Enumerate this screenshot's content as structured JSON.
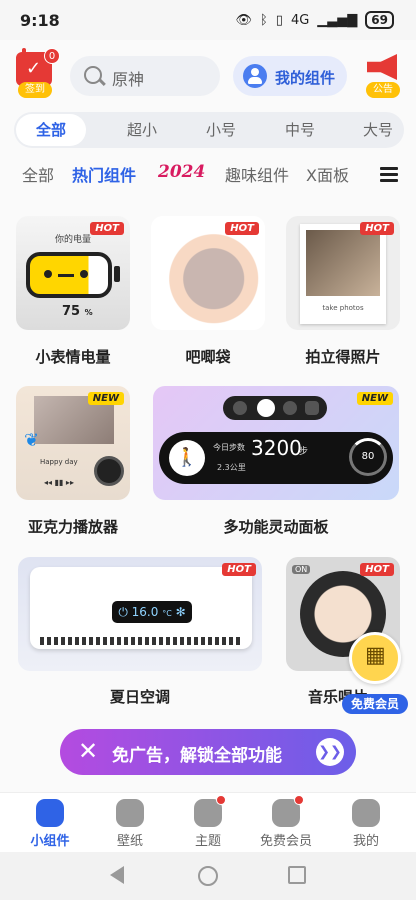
{
  "status": {
    "time": "9:18",
    "battery": "69",
    "signal": "4G"
  },
  "header": {
    "signin_label": "签到",
    "signin_badge": "0",
    "search_placeholder": "原神",
    "my_widgets": "我的组件",
    "notice_label": "公告"
  },
  "sizes": [
    "全部",
    "超小",
    "小号",
    "中号",
    "大号"
  ],
  "categories": [
    "全部",
    "热门组件",
    "2024",
    "趣味组件",
    "X面板"
  ],
  "cards": [
    {
      "title": "小表情电量",
      "badge": "HOT",
      "caption": "你的电量",
      "value": "75",
      "unit": "%"
    },
    {
      "title": "吧唧袋",
      "badge": "HOT"
    },
    {
      "title": "拍立得照片",
      "badge": "HOT",
      "caption": "take photos"
    },
    {
      "title": "亚克力播放器",
      "badge": "NEW",
      "caption": "Happy day"
    },
    {
      "title": "多功能灵动面板",
      "badge": "NEW",
      "steps_label": "今日步数",
      "steps": "3200",
      "steps_unit": "步",
      "distance": "2.3公里",
      "ring_value": "80"
    },
    {
      "title": "夏日空调",
      "badge": "HOT",
      "temp": "16.0",
      "temp_unit": "°C"
    },
    {
      "title": "音乐唱片",
      "badge": "HOT",
      "tag": "ON"
    }
  ],
  "promo": {
    "text": "免广告，解锁全部功能"
  },
  "vip_float": "免费会员",
  "bottom_nav": [
    "小组件",
    "壁纸",
    "主题",
    "免费会员",
    "我的"
  ],
  "colors": {
    "accent": "#2f63e6",
    "hot": "#e53935",
    "new": "#ffd400"
  }
}
